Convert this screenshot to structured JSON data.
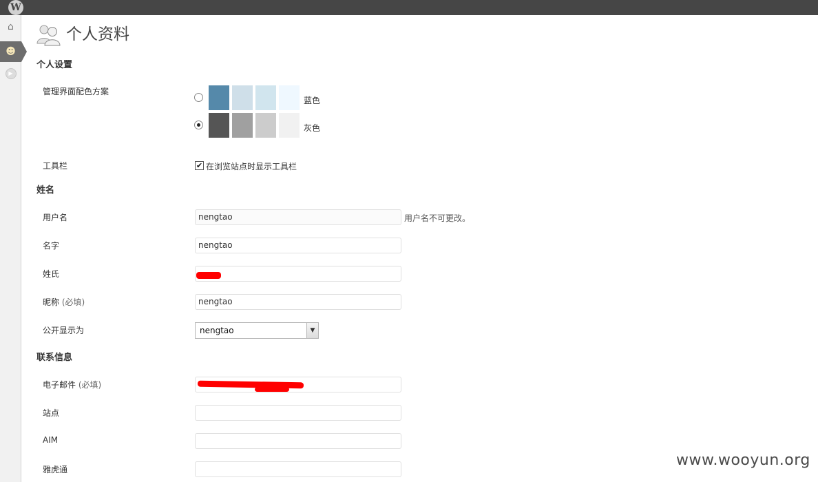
{
  "page": {
    "title": "个人资料"
  },
  "adminbar": {
    "logo": "W"
  },
  "menu": {
    "icons": [
      "home-icon",
      "users-icon",
      "collapse-icon"
    ],
    "home_glyph": "⌂",
    "users_glyph": "☻",
    "collapse_glyph": "▶"
  },
  "sections": {
    "personal": "个人设置",
    "name": "姓名",
    "contact": "联系信息"
  },
  "color_scheme": {
    "label": "管理界面配色方案",
    "options": [
      {
        "name": "蓝色",
        "selected": false,
        "colors": [
          "#5589aa",
          "#cfdfe9",
          "#d1e5ee",
          "#eff8ff"
        ]
      },
      {
        "name": "灰色",
        "selected": true,
        "colors": [
          "#555555",
          "#a0a0a0",
          "#cccccc",
          "#f1f1f1"
        ]
      }
    ]
  },
  "toolbar": {
    "label": "工具栏",
    "checkbox_label": "在浏览站点时显示工具栏",
    "checked": true,
    "check_glyph": "✔"
  },
  "fields": {
    "username": {
      "label": "用户名",
      "value": "nengtao",
      "description": "用户名不可更改。"
    },
    "first_name": {
      "label": "名字",
      "value": "nengtao"
    },
    "last_name": {
      "label": "姓氏",
      "value": ""
    },
    "nickname": {
      "label": "昵称",
      "required": "(必填)",
      "value": "nengtao"
    },
    "display_name": {
      "label": "公开显示为",
      "value": "nengtao",
      "arrow": "▼"
    },
    "email": {
      "label": "电子邮件",
      "required": "(必填)",
      "value": ""
    },
    "website": {
      "label": "站点",
      "value": ""
    },
    "aim": {
      "label": "AIM",
      "value": ""
    },
    "yim": {
      "label": "雅虎通",
      "value": ""
    }
  },
  "watermark": "www.wooyun.org"
}
